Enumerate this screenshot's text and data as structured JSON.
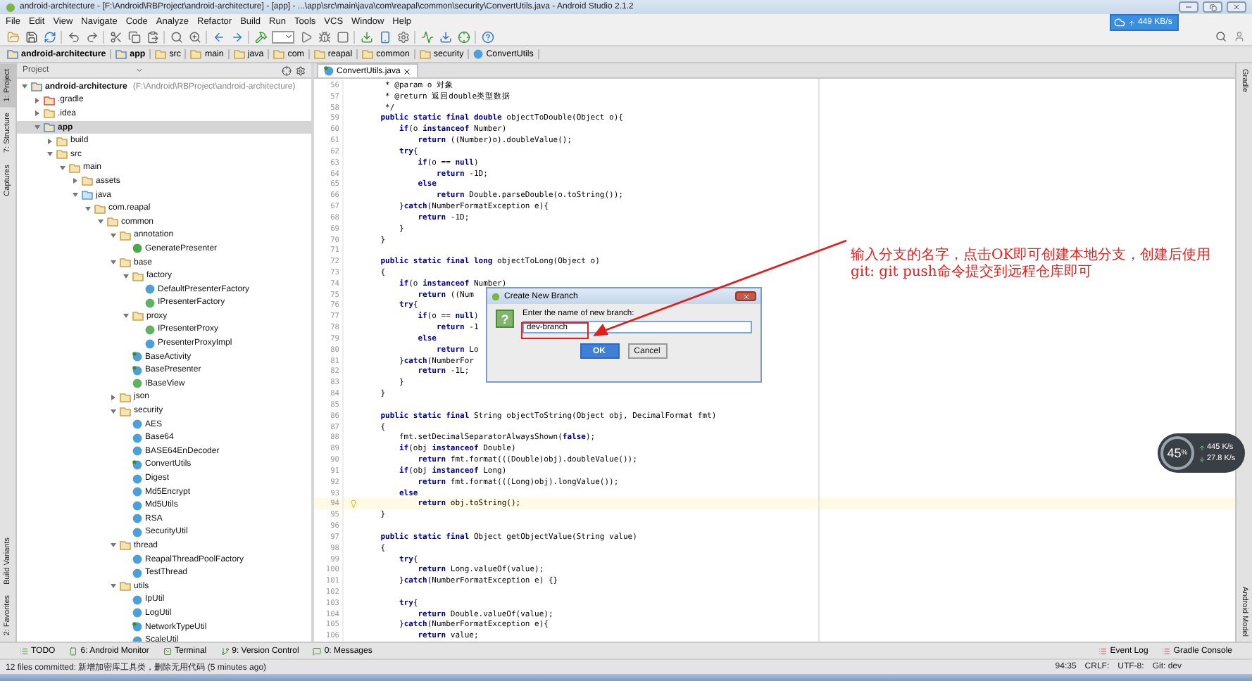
{
  "window": {
    "title": "android-architecture - [F:\\Android\\RBProject\\android-architecture] - [app] - ...\\app\\src\\main\\java\\com\\reapal\\common\\security\\ConvertUtils.java - Android Studio 2.1.2"
  },
  "menu": [
    "File",
    "Edit",
    "View",
    "Navigate",
    "Code",
    "Analyze",
    "Refactor",
    "Build",
    "Run",
    "Tools",
    "VCS",
    "Window",
    "Help"
  ],
  "network_widget": {
    "speed": "449 KB/s"
  },
  "breadcrumbs": [
    {
      "label": "android-architecture",
      "kind": "module"
    },
    {
      "label": "app",
      "kind": "module"
    },
    {
      "label": "src",
      "kind": "folder"
    },
    {
      "label": "main",
      "kind": "folder"
    },
    {
      "label": "java",
      "kind": "folder"
    },
    {
      "label": "com",
      "kind": "folder"
    },
    {
      "label": "reapal",
      "kind": "folder"
    },
    {
      "label": "common",
      "kind": "folder"
    },
    {
      "label": "security",
      "kind": "folder"
    },
    {
      "label": "ConvertUtils",
      "kind": "class"
    }
  ],
  "left_tool_tabs": [
    {
      "label": "1: Project",
      "selected": true
    },
    {
      "label": "7: Structure",
      "selected": false
    },
    {
      "label": "Captures",
      "selected": false
    },
    {
      "label": "Build Variants",
      "selected": false
    },
    {
      "label": "2: Favorites",
      "selected": false
    }
  ],
  "right_tool_tabs": [
    {
      "label": "Gradle",
      "selected": false
    },
    {
      "label": "Android Model",
      "selected": false
    }
  ],
  "project_panel": {
    "view": "Project"
  },
  "project_tree": [
    {
      "label": "android-architecture",
      "path": "(F:\\Android\\RBProject\\android-architecture)",
      "kind": "module",
      "selected": false,
      "expanded": true,
      "children": [
        {
          "label": ".gradle",
          "kind": "excluded",
          "selected": false,
          "expanded": false
        },
        {
          "label": ".idea",
          "kind": "folder",
          "selected": false,
          "expanded": false
        },
        {
          "label": "app",
          "kind": "module",
          "selected": true,
          "expanded": true,
          "children": [
            {
              "label": "build",
              "kind": "folder",
              "selected": false,
              "expanded": false
            },
            {
              "label": "src",
              "kind": "folder",
              "selected": false,
              "expanded": true,
              "children": [
                {
                  "label": "main",
                  "kind": "folder",
                  "selected": false,
                  "expanded": true,
                  "children": [
                    {
                      "label": "assets",
                      "kind": "resources",
                      "selected": false,
                      "expanded": false
                    },
                    {
                      "label": "java",
                      "kind": "source",
                      "selected": false,
                      "expanded": true,
                      "children": [
                        {
                          "label": "com.reapal",
                          "kind": "package",
                          "selected": false,
                          "expanded": true,
                          "children": [
                            {
                              "label": "common",
                              "kind": "package",
                              "selected": false,
                              "expanded": true,
                              "children": [
                                {
                                  "label": "annotation",
                                  "kind": "package",
                                  "selected": false,
                                  "expanded": true,
                                  "children": [
                                    {
                                      "label": "GeneratePresenter",
                                      "kind": "annotation",
                                      "selected": false
                                    }
                                  ]
                                },
                                {
                                  "label": "base",
                                  "kind": "package",
                                  "selected": false,
                                  "expanded": true,
                                  "children": [
                                    {
                                      "label": "factory",
                                      "kind": "package",
                                      "selected": false,
                                      "expanded": true,
                                      "children": [
                                        {
                                          "label": "DefaultPresenterFactory",
                                          "kind": "class",
                                          "selected": false
                                        },
                                        {
                                          "label": "IPresenterFactory",
                                          "kind": "interface",
                                          "selected": false
                                        }
                                      ]
                                    },
                                    {
                                      "label": "proxy",
                                      "kind": "package",
                                      "selected": false,
                                      "expanded": true,
                                      "children": [
                                        {
                                          "label": "IPresenterProxy",
                                          "kind": "interface",
                                          "selected": false
                                        },
                                        {
                                          "label": "PresenterProxyImpl",
                                          "kind": "class",
                                          "selected": false
                                        }
                                      ]
                                    },
                                    {
                                      "label": "BaseActivity",
                                      "kind": "abstract",
                                      "selected": false
                                    },
                                    {
                                      "label": "BasePresenter",
                                      "kind": "abstract",
                                      "selected": false
                                    },
                                    {
                                      "label": "IBaseView",
                                      "kind": "interface",
                                      "selected": false
                                    }
                                  ]
                                },
                                {
                                  "label": "json",
                                  "kind": "package",
                                  "selected": false,
                                  "expanded": false
                                },
                                {
                                  "label": "security",
                                  "kind": "package",
                                  "selected": false,
                                  "expanded": true,
                                  "children": [
                                    {
                                      "label": "AES",
                                      "kind": "class",
                                      "selected": false
                                    },
                                    {
                                      "label": "Base64",
                                      "kind": "class",
                                      "selected": false
                                    },
                                    {
                                      "label": "BASE64EnDecoder",
                                      "kind": "class",
                                      "selected": false
                                    },
                                    {
                                      "label": "ConvertUtils",
                                      "kind": "abstract",
                                      "selected": false
                                    },
                                    {
                                      "label": "Digest",
                                      "kind": "class",
                                      "selected": false
                                    },
                                    {
                                      "label": "Md5Encrypt",
                                      "kind": "class",
                                      "selected": false
                                    },
                                    {
                                      "label": "Md5Utils",
                                      "kind": "class",
                                      "selected": false
                                    },
                                    {
                                      "label": "RSA",
                                      "kind": "class",
                                      "selected": false
                                    },
                                    {
                                      "label": "SecurityUtil",
                                      "kind": "class",
                                      "selected": false
                                    }
                                  ]
                                },
                                {
                                  "label": "thread",
                                  "kind": "package",
                                  "selected": false,
                                  "expanded": true,
                                  "children": [
                                    {
                                      "label": "ReapalThreadPoolFactory",
                                      "kind": "class",
                                      "selected": false
                                    },
                                    {
                                      "label": "TestThread",
                                      "kind": "class",
                                      "selected": false
                                    }
                                  ]
                                },
                                {
                                  "label": "utils",
                                  "kind": "package",
                                  "selected": false,
                                  "expanded": true,
                                  "children": [
                                    {
                                      "label": "IpUtil",
                                      "kind": "class",
                                      "selected": false
                                    },
                                    {
                                      "label": "LogUtil",
                                      "kind": "class",
                                      "selected": false
                                    },
                                    {
                                      "label": "NetworkTypeUtil",
                                      "kind": "abstract",
                                      "selected": false
                                    },
                                    {
                                      "label": "ScaleUtil",
                                      "kind": "class",
                                      "selected": false
                                    }
                                  ]
                                }
                              ]
                            }
                          ]
                        }
                      ]
                    }
                  ]
                }
              ]
            }
          ]
        }
      ]
    }
  ],
  "editor": {
    "tabs": [
      {
        "label": "ConvertUtils.java",
        "selected": true
      }
    ],
    "lines": [
      {
        "num": "56",
        "text": "     * @param o 对象"
      },
      {
        "num": "57",
        "text": "     * @return 返回double类型数据"
      },
      {
        "num": "58",
        "text": "     */"
      },
      {
        "num": "59",
        "text": "    **public static final double** objectToDouble(Object o){"
      },
      {
        "num": "60",
        "text": "        **if**(o **instanceof** Number)"
      },
      {
        "num": "61",
        "text": "            **return** ((Number)o).doubleValue();"
      },
      {
        "num": "62",
        "text": "        **try**{"
      },
      {
        "num": "63",
        "text": "            **if**(o == **null**)"
      },
      {
        "num": "64",
        "text": "                **return** -1D;"
      },
      {
        "num": "65",
        "text": "            **else**"
      },
      {
        "num": "66",
        "text": "                **return** Double.parseDouble(o.toString());"
      },
      {
        "num": "67",
        "text": "        }**catch**(NumberFormatException e){"
      },
      {
        "num": "68",
        "text": "            **return** -1D;"
      },
      {
        "num": "69",
        "text": "        }"
      },
      {
        "num": "70",
        "text": "    }"
      },
      {
        "num": "71"
      },
      {
        "num": "72",
        "text": "    **public static final long** objectToLong(Object o)"
      },
      {
        "num": "73",
        "text": "    {"
      },
      {
        "num": "74",
        "text": "        **if**(o **instanceof** Number)"
      },
      {
        "num": "75",
        "text": "            **return** ((Num"
      },
      {
        "num": "76",
        "text": "        **try**{"
      },
      {
        "num": "77",
        "text": "            **if**(o == **null**)"
      },
      {
        "num": "78",
        "text": "                **return** -1"
      },
      {
        "num": "79",
        "text": "            **else**"
      },
      {
        "num": "80",
        "text": "                **return** Lo"
      },
      {
        "num": "81",
        "text": "        }**catch**(NumberFor"
      },
      {
        "num": "82",
        "text": "            **return** -1L;"
      },
      {
        "num": "83",
        "text": "        }"
      },
      {
        "num": "84",
        "text": "    }"
      },
      {
        "num": "85"
      },
      {
        "num": "86",
        "text": "    **public static final** String objectToString(Object obj, DecimalFormat fmt)"
      },
      {
        "num": "87",
        "text": "    {"
      },
      {
        "num": "88",
        "text": "        fmt.setDecimalSeparatorAlwaysShown(**false**);"
      },
      {
        "num": "89",
        "text": "        **if**(obj **instanceof** Double)"
      },
      {
        "num": "90",
        "text": "            **return** fmt.format(((Double)obj).doubleValue());"
      },
      {
        "num": "91",
        "text": "        **if**(obj **instanceof** Long)"
      },
      {
        "num": "92",
        "text": "            **return** fmt.format(((Long)obj).longValue());"
      },
      {
        "num": "93",
        "text": "        **else**"
      },
      {
        "num": "94",
        "text": "            **return** obj.toString();",
        "current": true
      },
      {
        "num": "95",
        "text": "    }"
      },
      {
        "num": "96"
      },
      {
        "num": "97",
        "text": "    **public static final** Object getObjectValue(String value)"
      },
      {
        "num": "98",
        "text": "    {"
      },
      {
        "num": "99",
        "text": "        **try**{"
      },
      {
        "num": "100",
        "text": "            **return** Long.valueOf(value);"
      },
      {
        "num": "101",
        "text": "        }**catch**(NumberFormatException e) {}"
      },
      {
        "num": "102"
      },
      {
        "num": "103",
        "text": "        **try**{"
      },
      {
        "num": "104",
        "text": "            **return** Double.valueOf(value);"
      },
      {
        "num": "105",
        "text": "        }**catch**(NumberFormatException e){"
      },
      {
        "num": "106",
        "text": "            **return** value;"
      }
    ]
  },
  "dialog": {
    "title": "Create New Branch",
    "icon_glyph": "?",
    "prompt": "Enter the name of new branch:",
    "value": "dev-branch",
    "buttons": [
      {
        "label": "OK",
        "default": true
      },
      {
        "label": "Cancel",
        "default": false
      }
    ]
  },
  "annotation": {
    "text": "输入分支的名字，点击OK即可创建本地分支，创建后使用git: git push命令提交到远程仓库即可"
  },
  "speed_widget": {
    "percent": "45",
    "unit": "%",
    "upload": "445 K/s",
    "download": "27.8 K/s"
  },
  "bottom_tool_tabs": [
    {
      "label": "TODO",
      "selected": false
    },
    {
      "label": "6: Android Monitor",
      "selected": false
    },
    {
      "label": "Terminal",
      "selected": false
    },
    {
      "label": "9: Version Control",
      "selected": false
    },
    {
      "label": "0: Messages",
      "selected": false
    }
  ],
  "bottom_tool_tabs_right": [
    {
      "label": "Event Log",
      "selected": false
    },
    {
      "label": "Gradle Console",
      "selected": false
    }
  ],
  "status_bar": {
    "message": "12 files committed: 新增加密库工具类，删除无用代码 (5 minutes ago)",
    "position": "94:35",
    "line_separator": "CRLF:",
    "encoding": "UTF-8:",
    "vcs": "Git: dev"
  }
}
